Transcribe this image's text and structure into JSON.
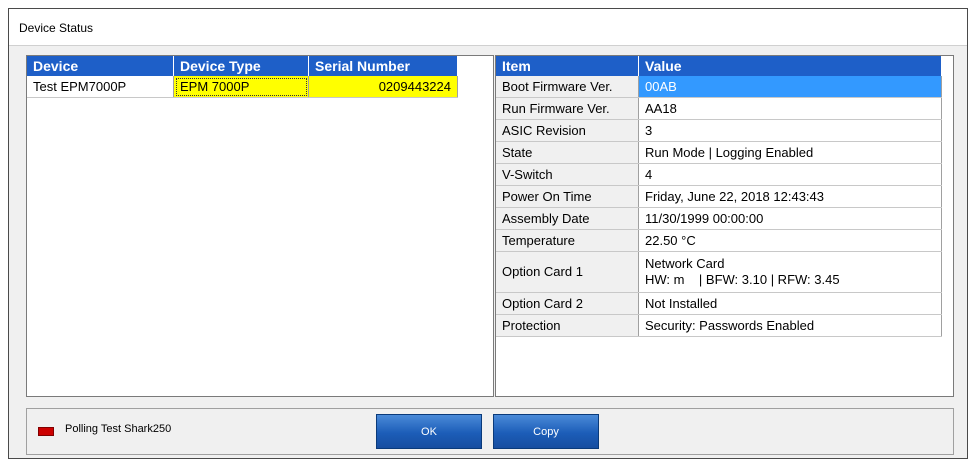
{
  "window": {
    "title": "Device Status"
  },
  "devices": {
    "headers": [
      "Device",
      "Device Type",
      "Serial Number"
    ],
    "rows": [
      {
        "device": "Test EPM7000P",
        "type": "EPM 7000P",
        "serial": "0209443224"
      }
    ]
  },
  "properties": {
    "headers": [
      "Item",
      "Value"
    ],
    "rows": [
      {
        "item": "Boot Firmware Ver.",
        "value": "00AB"
      },
      {
        "item": "Run Firmware Ver.",
        "value": "AA18"
      },
      {
        "item": "ASIC Revision",
        "value": "3"
      },
      {
        "item": "State",
        "value": "Run Mode | Logging Enabled"
      },
      {
        "item": "V-Switch",
        "value": "4"
      },
      {
        "item": "Power On Time",
        "value": "Friday, June 22, 2018 12:43:43"
      },
      {
        "item": "Assembly Date",
        "value": "11/30/1999 00:00:00"
      },
      {
        "item": "Temperature",
        "value": "22.50 °C"
      },
      {
        "item": "Option Card 1",
        "value": "Network Card",
        "value2": "HW: m    | BFW: 3.10 | RFW: 3.45"
      },
      {
        "item": "Option Card 2",
        "value": "Not Installed"
      },
      {
        "item": "Protection",
        "value": "Security: Passwords Enabled"
      }
    ]
  },
  "status": {
    "polling_label": "Polling Test Shark250",
    "indicator_color": "#cc0000"
  },
  "buttons": {
    "ok": "OK",
    "copy": "Copy"
  }
}
